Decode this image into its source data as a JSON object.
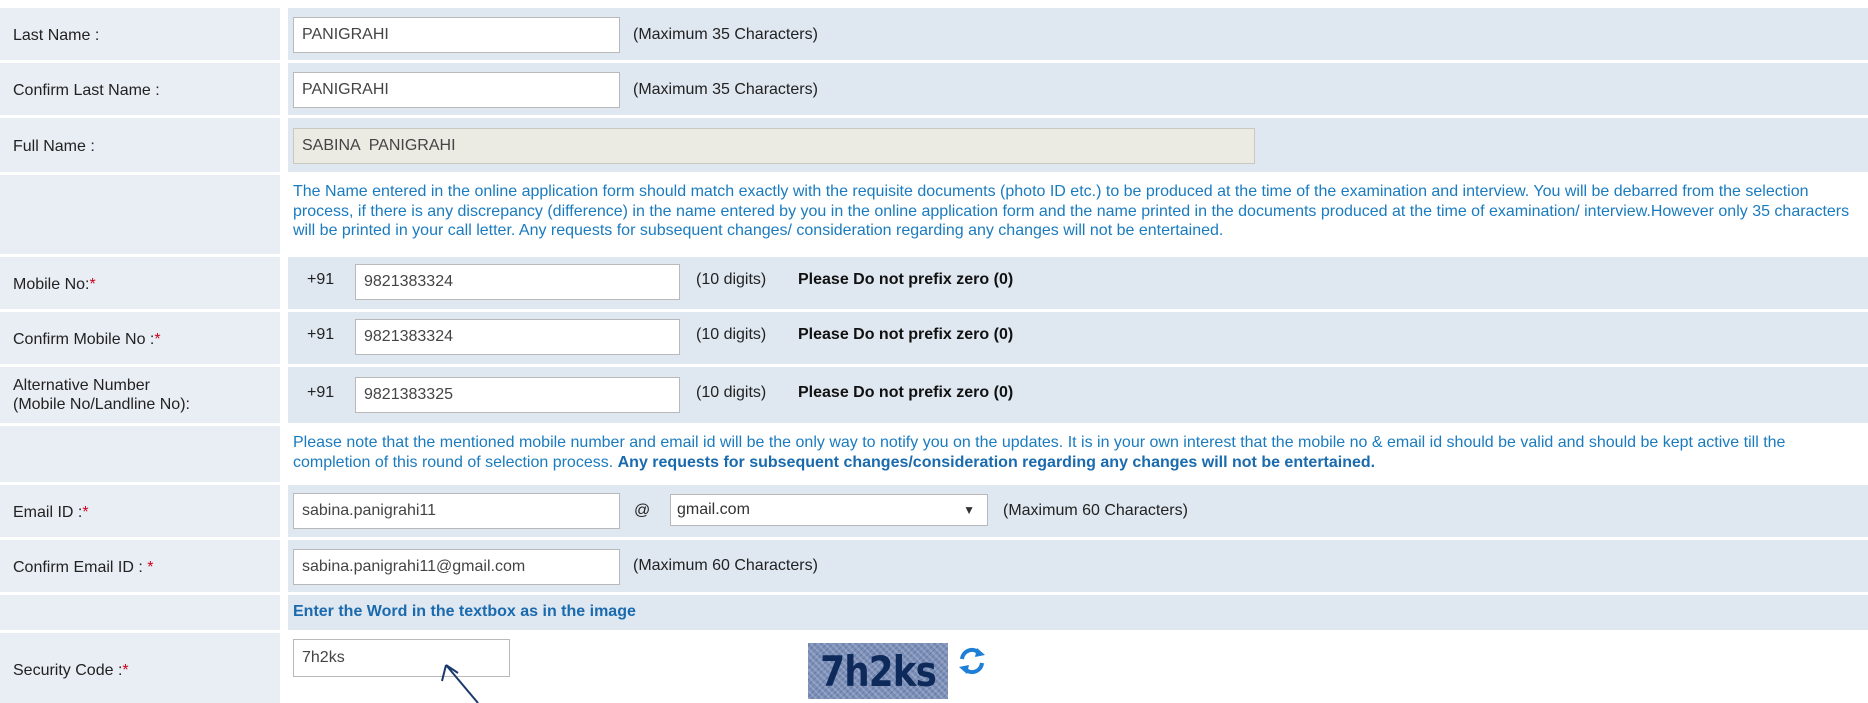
{
  "last_name": {
    "label": "Last Name :",
    "value": "PANIGRAHI",
    "hint": "(Maximum 35 Characters)"
  },
  "confirm_last_name": {
    "label": "Confirm Last Name :",
    "value": "PANIGRAHI",
    "hint": "(Maximum 35 Characters)"
  },
  "full_name": {
    "label": "Full Name :",
    "value": "SABINA  PANIGRAHI"
  },
  "name_notice": "The Name entered in the online application form should match exactly with the requisite documents (photo ID etc.) to be produced at the time of the examination and interview. You will be debarred from the selection process, if there is any discrepancy (difference) in the name entered by you in the online application form and the name printed in the documents produced at the time of examination/ interview.However only 35 characters will be printed in your call letter. Any requests for subsequent changes/ consideration regarding any changes will not be entertained.",
  "mobile": {
    "label": "Mobile No:",
    "required": "*",
    "prefix": "+91",
    "value": "9821383324",
    "digits": "(10 digits)",
    "warning": "Please Do not prefix zero (0)"
  },
  "confirm_mobile": {
    "label": "Confirm Mobile No :",
    "required": "*",
    "prefix": "+91",
    "value": "9821383324",
    "digits": "(10 digits)",
    "warning": "Please Do not prefix zero (0)"
  },
  "alt_number": {
    "label_line1": "Alternative Number",
    "label_line2": "(Mobile No/Landline No):",
    "prefix": "+91",
    "value": "9821383325",
    "digits": "(10 digits)",
    "warning": "Please Do not prefix zero (0)"
  },
  "contact_notice": {
    "text": "Please note that the mentioned mobile number and email id will be the only way to notify you on the updates. It is in your own interest that the mobile no & email id should be valid and should be kept active till the completion of this round of selection process. ",
    "bold": "Any requests for subsequent changes/consideration regarding any changes will not be entertained."
  },
  "email": {
    "label": "Email ID :",
    "required": "*",
    "value": "sabina.panigrahi11",
    "at": "@",
    "domain": "gmail.com",
    "hint": "(Maximum 60 Characters)"
  },
  "confirm_email": {
    "label": "Confirm Email ID : ",
    "required": "*",
    "value": "sabina.panigrahi11@gmail.com",
    "hint": "(Maximum 60 Characters)"
  },
  "captcha_instruction": "Enter the Word in the textbox as in the image",
  "security": {
    "label": "Security Code :",
    "required": "*",
    "value": "7h2ks",
    "captcha_text": "7h2ks"
  },
  "icons": {
    "refresh": "refresh-icon",
    "dropdown": "chevron-down-icon",
    "pointer": "arrow-cursor-icon"
  },
  "colors": {
    "label_bg": "#e9eef4",
    "field_bg": "#dfe7f0",
    "info_text": "#1a7bbf",
    "required": "#d0021b"
  }
}
